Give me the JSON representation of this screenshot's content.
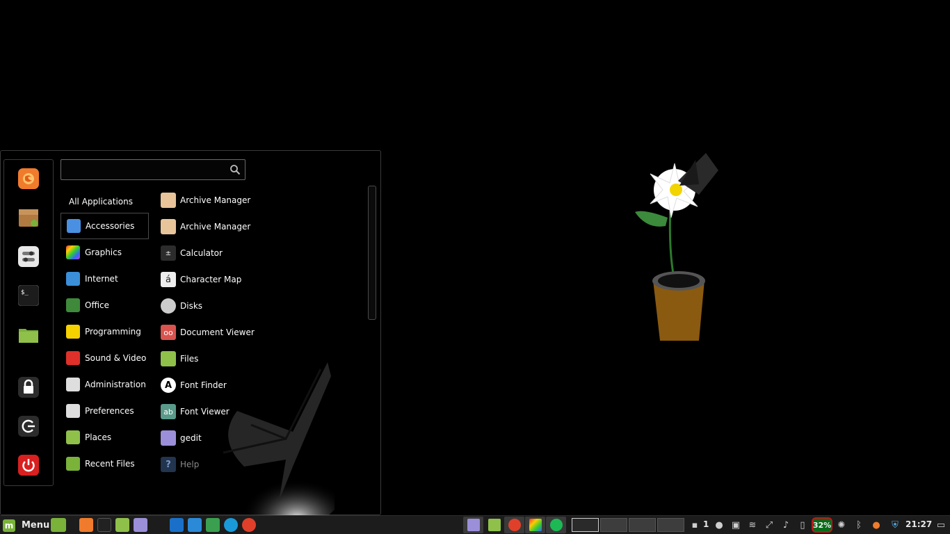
{
  "menu": {
    "search": {
      "value": "",
      "placeholder": ""
    },
    "favorites": [
      "firefox-icon",
      "software-manager-icon",
      "system-settings-icon",
      "terminal-icon",
      "files-icon"
    ],
    "session_actions": [
      "lock-icon",
      "logout-icon",
      "shutdown-icon"
    ],
    "categories": [
      {
        "label": "All Applications",
        "icon": ""
      },
      {
        "label": "Accessories",
        "icon": "accessories-icon"
      },
      {
        "label": "Graphics",
        "icon": "graphics-icon"
      },
      {
        "label": "Internet",
        "icon": "internet-icon"
      },
      {
        "label": "Office",
        "icon": "office-icon"
      },
      {
        "label": "Programming",
        "icon": "programming-icon"
      },
      {
        "label": "Sound & Video",
        "icon": "sound-video-icon"
      },
      {
        "label": "Administration",
        "icon": "administration-icon"
      },
      {
        "label": "Preferences",
        "icon": "preferences-icon"
      },
      {
        "label": "Places",
        "icon": "places-icon"
      },
      {
        "label": "Recent Files",
        "icon": "recent-files-icon"
      }
    ],
    "selected_category": "Accessories",
    "apps": [
      {
        "label": "Archive Manager",
        "icon": "archive-manager-icon"
      },
      {
        "label": "Archive Manager",
        "icon": "archive-manager-icon"
      },
      {
        "label": "Calculator",
        "icon": "calculator-icon"
      },
      {
        "label": "Character Map",
        "icon": "character-map-icon"
      },
      {
        "label": "Disks",
        "icon": "disks-icon"
      },
      {
        "label": "Document Viewer",
        "icon": "document-viewer-icon"
      },
      {
        "label": "Files",
        "icon": "files-icon"
      },
      {
        "label": "Font Finder",
        "icon": "font-finder-icon"
      },
      {
        "label": "Font Viewer",
        "icon": "font-viewer-icon"
      },
      {
        "label": "gedit",
        "icon": "gedit-icon"
      },
      {
        "label": "Help",
        "icon": "help-icon"
      }
    ]
  },
  "panel": {
    "menu_label": "Menu",
    "notification_count": "1",
    "battery": "32%",
    "clock": "21:27"
  },
  "colors": {
    "panel_bg": "#1c1c1c",
    "menu_border": "#3a3a3a",
    "mint_green": "#7ab23a",
    "battery_border": "#c0181b"
  }
}
